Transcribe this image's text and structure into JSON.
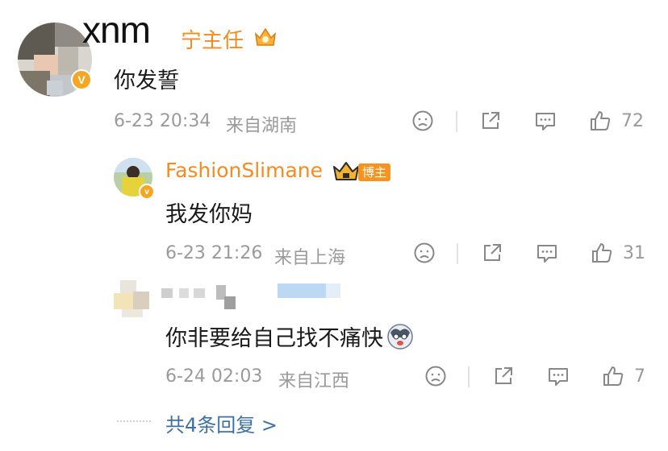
{
  "comment": {
    "username": "xnm",
    "role_label": "宁主任",
    "text": "你发誓",
    "date": "6-23 20:34",
    "location": "来自湖南",
    "like_count": "72"
  },
  "replies": [
    {
      "username": "FashionSlimane",
      "badge": "博主",
      "text": "我发你妈",
      "date": "6-23 21:26",
      "location": "来自上海",
      "like_count": "31"
    },
    {
      "username": "",
      "text": "你非要给自己找不痛快",
      "date": "6-24 02:03",
      "location": "来自江西",
      "like_count": "7"
    }
  ],
  "more_replies": "共4条回复 >",
  "colors": {
    "accent": "#f58b1f",
    "meta": "#9a9a9a",
    "verified": "#f5a623"
  },
  "icons": [
    "dislike-icon",
    "share-icon",
    "comment-icon",
    "like-icon",
    "crown-icon",
    "emoji-icon"
  ]
}
